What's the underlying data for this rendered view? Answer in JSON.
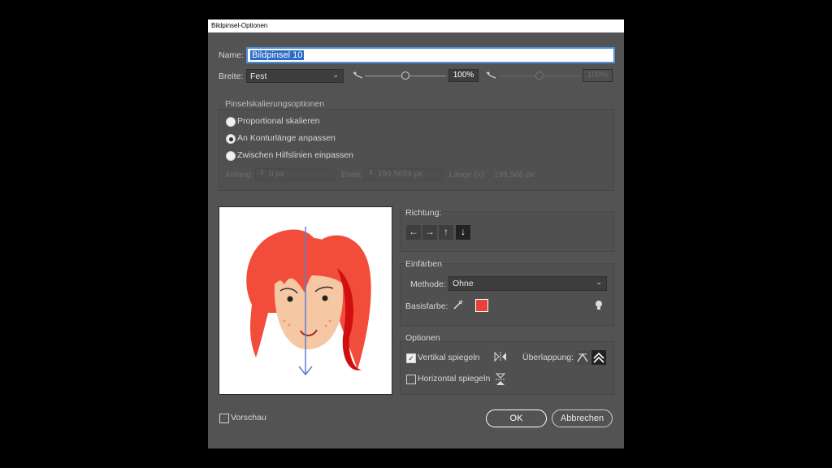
{
  "window": {
    "title": "Bildpinsel-Optionen"
  },
  "name": {
    "label": "Name:",
    "value": "Bildpinsel 10"
  },
  "width": {
    "label": "Breite:",
    "value": "Fest",
    "percent": "100%",
    "percent2": "100%",
    "slider_level": 0.5
  },
  "scaling": {
    "title": "Pinselskalierungsoptionen",
    "options": [
      "Proportional skalieren",
      "An Konturlänge anpassen",
      "Zwischen Hilfslinien einpassen"
    ],
    "selected_index": 1,
    "start_label": "Anfang:",
    "start_value": "0 px",
    "end_label": "Ende:",
    "end_value": "199,5659 px",
    "length_label": "Länge (x):",
    "length_value": "199,566 px"
  },
  "direction": {
    "label": "Richtung:",
    "buttons": [
      "←",
      "→",
      "↑",
      "↓"
    ],
    "selected_index": 3
  },
  "colorize": {
    "title": "Einfärben",
    "method_label": "Methode:",
    "method_value": "Ohne",
    "key_color_label": "Basisfarbe:",
    "key_color": "#e8413b"
  },
  "options": {
    "title": "Optionen",
    "flip_vertical": "Vertikal spiegeln",
    "flip_vertical_checked": true,
    "flip_horizontal": "Horizontal spiegeln",
    "flip_horizontal_checked": false,
    "overlap_label": "Überlappung:"
  },
  "preview": {
    "label": "Vorschau",
    "checked": false
  },
  "buttons": {
    "ok": "OK",
    "cancel": "Abbrechen"
  },
  "colors": {
    "dialog_bg": "#535353",
    "accent": "#2b6cc4",
    "hair": "#f24d3b",
    "skin": "#f6c7a3",
    "arrow": "#5b7fd6"
  }
}
